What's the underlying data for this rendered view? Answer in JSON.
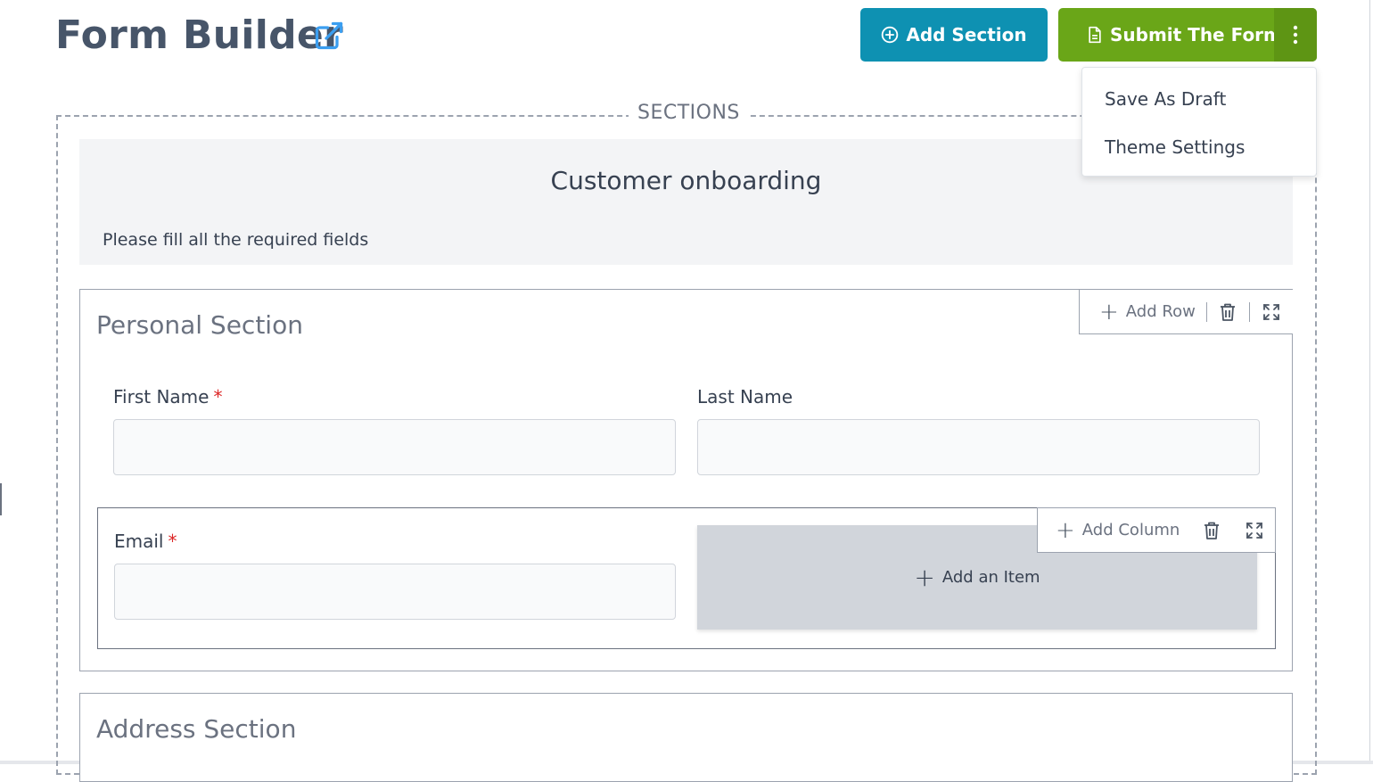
{
  "header": {
    "title": "Form Builder",
    "add_section_label": "Add Section",
    "submit_label": "Submit The Form"
  },
  "menu": {
    "items": [
      "Save As Draft",
      "Theme Settings"
    ]
  },
  "sections_legend": "SECTIONS",
  "form": {
    "title": "Customer onboarding",
    "description": "Please fill all the required fields"
  },
  "personal_section": {
    "title": "Personal Section",
    "toolbar": {
      "add_row_label": "Add Row"
    },
    "fields": {
      "first_name": {
        "label": "First Name",
        "required_mark": "*",
        "value": ""
      },
      "last_name": {
        "label": "Last Name",
        "value": ""
      },
      "email": {
        "label": "Email",
        "required_mark": "*",
        "value": ""
      }
    },
    "row_toolbar": {
      "add_column_label": "Add Column"
    },
    "add_item_label": "Add an Item"
  },
  "address_section": {
    "title": "Address Section"
  },
  "colors": {
    "add_section_button": "#0e91b2",
    "submit_button": "#6aa618",
    "required": "#dc2626"
  }
}
